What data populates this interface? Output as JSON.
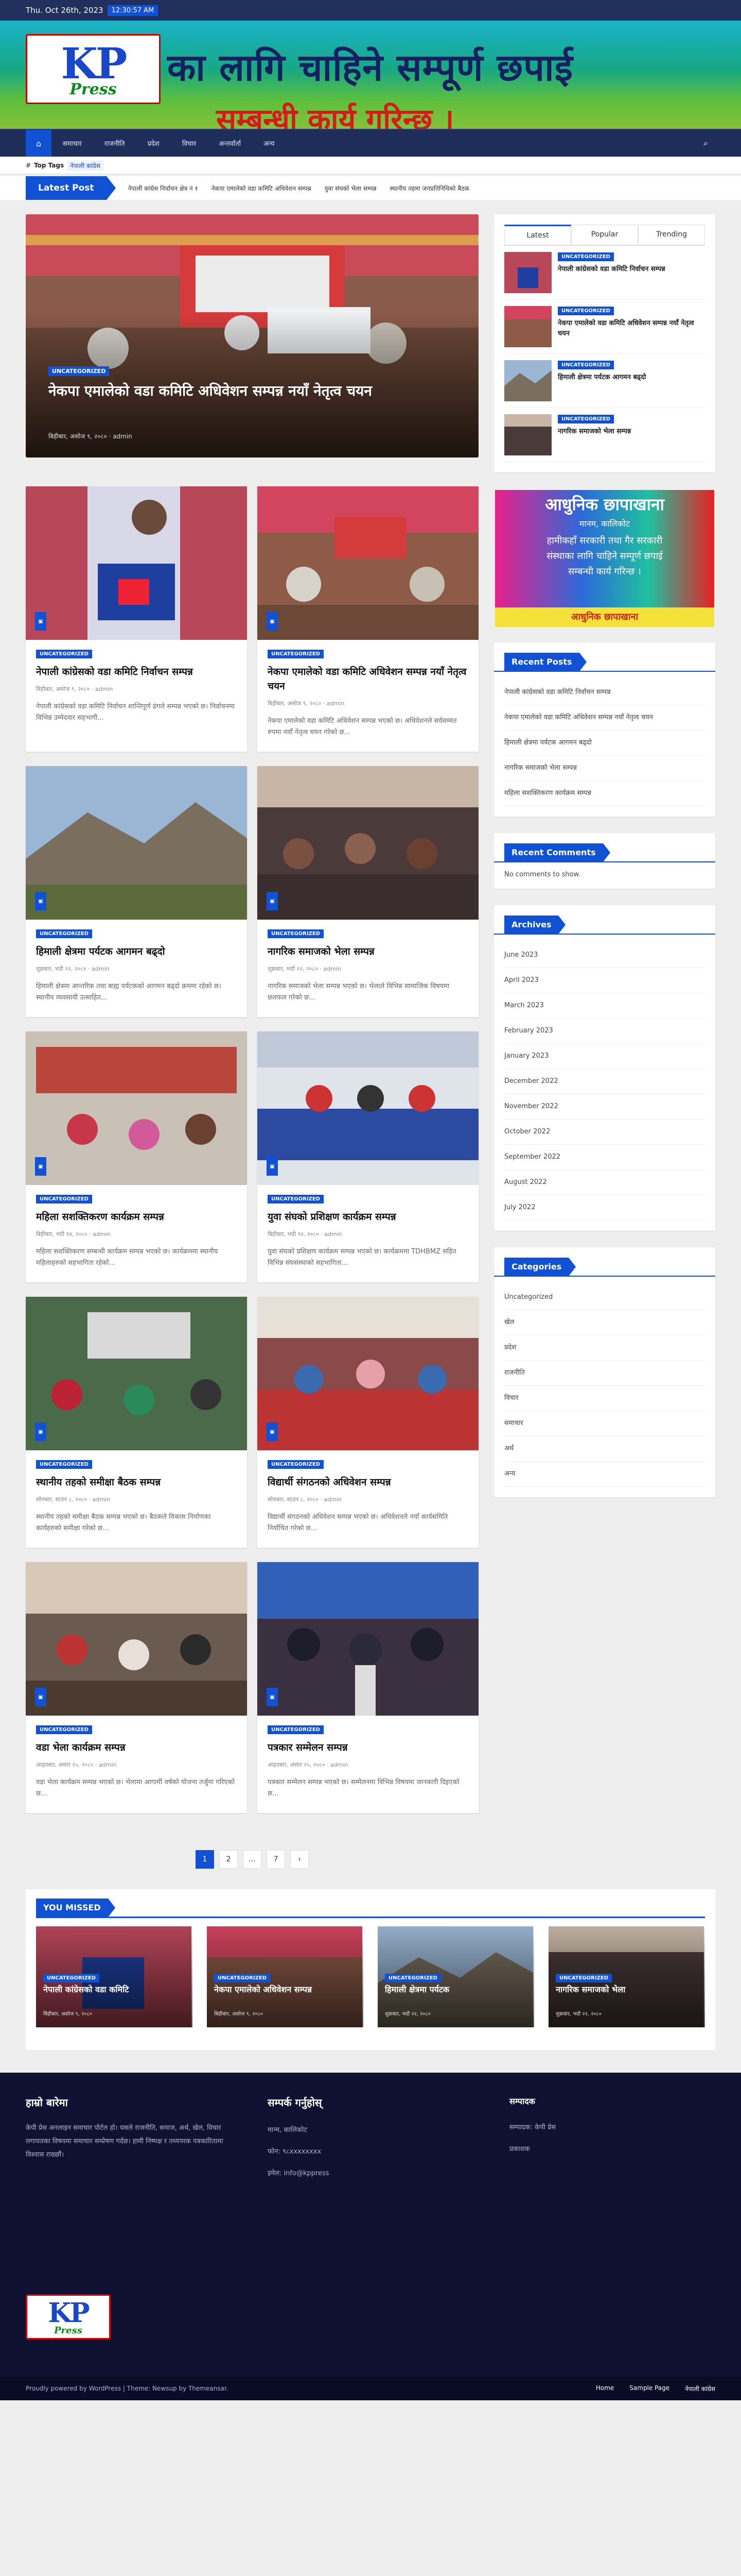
{
  "topbar": {
    "date": "Thu. Oct 26th, 2023",
    "time": "12:30:57 AM"
  },
  "header": {
    "logo_text": "KP",
    "logo_sub": "Press",
    "banner_line1": "का लागि चाहिने  सम्पूर्ण छपाई",
    "banner_line2": "सम्बन्धी कार्य गरिन्छ ।"
  },
  "nav": {
    "home_icon": "home-icon",
    "items": [
      "समाचार",
      "राजनीति",
      "प्रदेश",
      "विचार",
      "अन्तर्वार्ता",
      "अन्य"
    ],
    "search_icon": "search-icon"
  },
  "tags": {
    "label": "Top Tags",
    "items": [
      "नेपाली कांग्रेस"
    ]
  },
  "ticker": {
    "label": "Latest Post",
    "items": [
      "नेपाली कांग्रेस निर्वाचन क्षेत्र नं १",
      "नेकपा एमालेको वडा कमिटि अधिवेशन सम्पन्न",
      "युवा संघको भेला सम्पन्न",
      "स्थानीय तहमा जनप्रतिनिधिको बैठक"
    ]
  },
  "hero": {
    "category": "UNCATEGORIZED",
    "title": "नेकपा एमालेको वडा कमिटि अधिवेशन सम्पन्न नयाँ नेतृत्व चयन",
    "meta": "बिहीबार, असोज ९, २०८० · admin"
  },
  "posts": [
    {
      "category": "UNCATEGORIZED",
      "title": "नेपाली कांग्रेसको वडा कमिटि निर्वाचन सम्पन्न",
      "meta": "बिहीबार, असोज ९, २०८० · admin",
      "excerpt": "नेपाली कांग्रेसको वडा कमिटि निर्वाचन शान्तिपूर्ण ढंगले सम्पन्न भएको छ। निर्वाचनमा विभिन्न उम्मेदवार सहभागी..."
    },
    {
      "category": "UNCATEGORIZED",
      "title": "नेकपा एमालेको वडा कमिटि अधिवेशन सम्पन्न नयाँ नेतृत्व चयन",
      "meta": "बिहीबार, असोज ९, २०८० · admin",
      "excerpt": "नेकपा एमालेको वडा कमिटि अधिवेशन सम्पन्न भएको छ। अधिवेशनले सर्वसम्मत रुपमा नयाँ नेतृत्व चयन गरेको छ..."
    },
    {
      "category": "UNCATEGORIZED",
      "title": "हिमाली क्षेत्रमा पर्यटक आगमन बढ्दो",
      "meta": "शुक्रबार, भदौ २२, २०८० · admin",
      "excerpt": "हिमाली क्षेत्रमा आन्तरिक तथा बाह्य पर्यटकको आगमन बढ्दो क्रममा रहेको छ। स्थानीय व्यवसायी उत्साहित..."
    },
    {
      "category": "UNCATEGORIZED",
      "title": "नागरिक समाजको भेला सम्पन्न",
      "meta": "शुक्रबार, भदौ २२, २०८० · admin",
      "excerpt": "नागरिक समाजको भेला सम्पन्न भएको छ। भेलाले विभिन्न सामाजिक विषयमा छलफल गरेको छ..."
    },
    {
      "category": "UNCATEGORIZED",
      "title": "महिला सशक्तिकरण कार्यक्रम सम्पन्न",
      "meta": "बिहीबार, भदौ १४, २०८० · admin",
      "excerpt": "महिला सशक्तिकरण सम्बन्धी कार्यक्रम सम्पन्न भएको छ। कार्यक्रममा स्थानीय महिलाहरुको सहभागिता रहेको..."
    },
    {
      "category": "UNCATEGORIZED",
      "title": "युवा संघको प्रशिक्षण कार्यक्रम सम्पन्न",
      "meta": "बिहीबार, भदौ १४, २०८० · admin",
      "excerpt": "युवा संघको प्रशिक्षण कार्यक्रम सम्पन्न भएको छ। कार्यक्रममा TDHBMZ सहित विभिन्न संघसंस्थाको सहभागिता..."
    },
    {
      "category": "UNCATEGORIZED",
      "title": "स्थानीय तहको समीक्षा बैठक सम्पन्न",
      "meta": "सोमबार, साउन ८, २०८० · admin",
      "excerpt": "स्थानीय तहको समीक्षा बैठक सम्पन्न भएको छ। बैठकले विकास निर्माणका कार्यहरुको समीक्षा गरेको छ..."
    },
    {
      "category": "UNCATEGORIZED",
      "title": "विद्यार्थी संगठनको अधिवेशन सम्पन्न",
      "meta": "सोमबार, साउन ८, २०८० · admin",
      "excerpt": "विद्यार्थी संगठनको अधिवेशन सम्पन्न भएको छ। अधिवेशनले नयाँ कार्यसमिति निर्वाचित गरेको छ..."
    },
    {
      "category": "UNCATEGORIZED",
      "title": "वडा भेला कार्यक्रम सम्पन्न",
      "meta": "आइतबार, असार २५, २०८० · admin",
      "excerpt": "वडा भेला कार्यक्रम सम्पन्न भएको छ। भेलामा आगामी वर्षको योजना तर्जुमा गरिएको छ..."
    },
    {
      "category": "UNCATEGORIZED",
      "title": "पत्रकार सम्मेलन सम्पन्न",
      "meta": "आइतबार, असार २५, २०८० · admin",
      "excerpt": "पत्रकार सम्मेलन सम्पन्न भएको छ। सम्मेलनमा विभिन्न विषयमा जानकारी दिइएको छ..."
    }
  ],
  "pagination": [
    "1",
    "2",
    "…",
    "7",
    "›"
  ],
  "sidebar": {
    "tabs": [
      "Latest",
      "Popular",
      "Trending"
    ],
    "tab_items": [
      {
        "category": "UNCATEGORIZED",
        "title": "नेपाली कांग्रेसको वडा कमिटि निर्वाचन सम्पन्न"
      },
      {
        "category": "UNCATEGORIZED",
        "title": "नेकपा एमालेको वडा कमिटि अधिवेशन सम्पन्न नयाँ नेतृत्व चयन"
      },
      {
        "category": "UNCATEGORIZED",
        "title": "हिमाली क्षेत्रमा पर्यटक आगमन बढ्दो"
      },
      {
        "category": "UNCATEGORIZED",
        "title": "नागरिक समाजको भेला सम्पन्न"
      }
    ],
    "ad": {
      "line1": "आधुनिक छापाखाना",
      "line2": "मानम, कालिकोट",
      "line3": "हामीकहाँ सरकारी तथा गैर सरकारी",
      "line4": "संस्थाका लागि चाहिने सम्पूर्ण छपाई",
      "line5": "सम्बन्धी कार्य गरिन्छ ।",
      "line6": "आधुनिक छापाखाना"
    },
    "recent_title": "Recent Posts",
    "recent": [
      "नेपाली कांग्रेसको वडा कमिटि निर्वाचन सम्पन्न",
      "नेकपा एमालेको वडा कमिटि अधिवेशन सम्पन्न नयाँ नेतृत्व चयन",
      "हिमाली क्षेत्रमा पर्यटक आगमन बढ्दो",
      "नागरिक समाजको भेला सम्पन्न",
      "महिला सशक्तिकरण कार्यक्रम सम्पन्न"
    ],
    "comments_title": "Recent Comments",
    "comments_empty": "No comments to show.",
    "archives_title": "Archives",
    "archives": [
      "June 2023",
      "April 2023",
      "March 2023",
      "February 2023",
      "January 2023",
      "December 2022",
      "November 2022",
      "October 2022",
      "September 2022",
      "August 2022",
      "July 2022"
    ],
    "categories_title": "Categories",
    "categories": [
      "Uncategorized",
      "खेल",
      "प्रदेश",
      "राजनीति",
      "विचार",
      "समाचार",
      "अर्थ",
      "अन्य"
    ]
  },
  "missed": {
    "title": "YOU MISSED",
    "items": [
      {
        "category": "UNCATEGORIZED",
        "title": "नेपाली कांग्रेसको वडा कमिटि",
        "meta": "बिहीबार, असोज ९, २०८०"
      },
      {
        "category": "UNCATEGORIZED",
        "title": "नेकपा एमालेको अधिवेशन सम्पन्न",
        "meta": "बिहीबार, असोज ९, २०८०"
      },
      {
        "category": "UNCATEGORIZED",
        "title": "हिमाली क्षेत्रमा पर्यटक",
        "meta": "शुक्रबार, भदौ २२, २०८०"
      },
      {
        "category": "UNCATEGORIZED",
        "title": "नागरिक समाजको भेला",
        "meta": "शुक्रबार, भदौ २२, २०८०"
      }
    ]
  },
  "footer": {
    "col1_title": "हाम्रो बारेमा",
    "col1_text": "केपी प्रेस अनलाइन समाचार पोर्टल हो। यसले राजनीति, समाज, अर्थ, खेल, विचार लगायतका विषयमा समाचार सम्प्रेषण गर्दछ। हामी निष्पक्ष र तथ्यपरक पत्रकारितामा विश्वास राख्छौं।",
    "col2_title": "सम्पर्क गर्नुहोस्",
    "col2_items": [
      "मान्म, कालिकोट",
      "फोन: ९८xxxxxxxx",
      "इमेल: info@kppress"
    ],
    "col3_title": "सम्पादक",
    "col3_items": [
      "सम्पादक: केपी प्रेस",
      "प्रकाशक"
    ],
    "logo_text": "KP",
    "logo_sub": "Press"
  },
  "bottombar": {
    "copyright": "Proudly powered by WordPress | Theme: Newsup by Themeansar.",
    "menu": [
      "Home",
      "Sample Page",
      "नेपाली कांग्रेस"
    ]
  }
}
